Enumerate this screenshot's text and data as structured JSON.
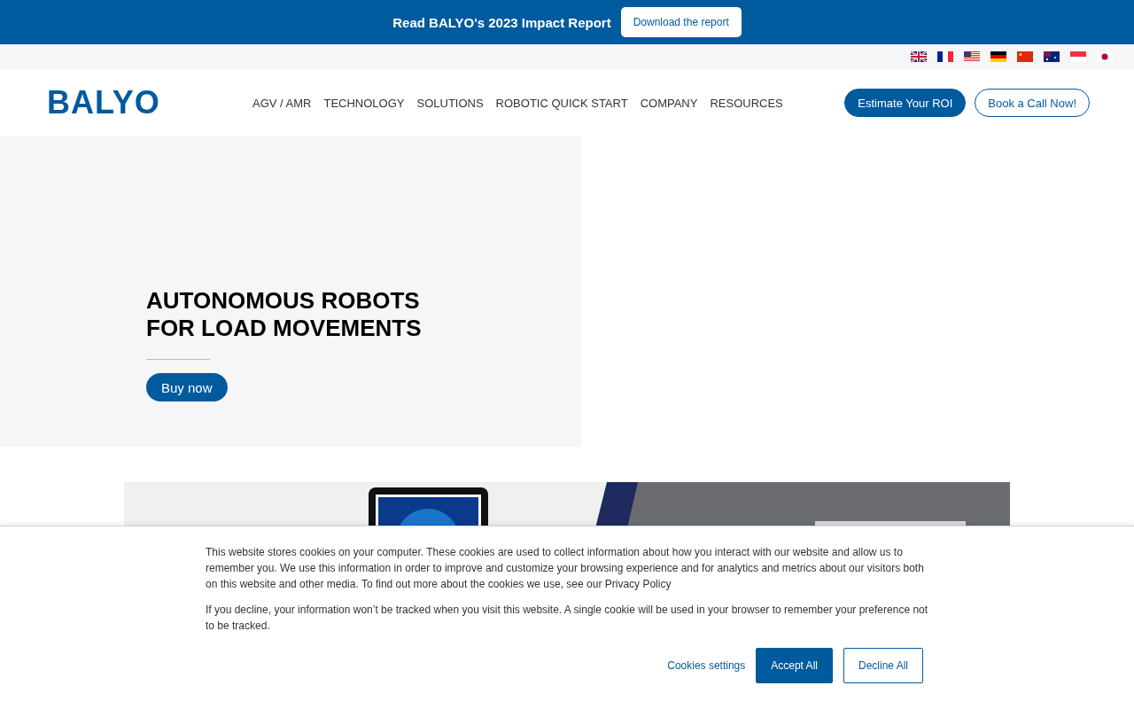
{
  "announcement": {
    "text": "Read BALYO's 2023 Impact Report",
    "button": "Download the report"
  },
  "nav": {
    "logo": "BALYO",
    "items": [
      "AGV / AMR",
      "TECHNOLOGY",
      "SOLUTIONS",
      "ROBOTIC QUICK START",
      "COMPANY",
      "RESOURCES"
    ],
    "primary_button": "Estimate Your ROI",
    "secondary_button": "Book a Call Now!"
  },
  "hero": {
    "title_lines": [
      "AUTONOMOUS ROBOTS",
      "FOR LOAD MOVEMENTS"
    ],
    "button": "Buy now"
  },
  "cookie_notice": {
    "paragraphs": [
      "This website stores cookies on your computer. These cookies are used to collect information about how you interact with our website and allow us to remember you. We use this information in order to improve and customize your browsing experience and for analytics and metrics about our visitors both on this website and other media. To find out more about the cookies we use, see our Privacy Policy",
      "If you decline, your information won’t be tracked when you visit this website. A single cookie will be used in your browser to remember your preference not to be tracked."
    ],
    "settings_link": "Cookies settings",
    "accept_button": "Accept All",
    "decline_button": "Decline All"
  }
}
